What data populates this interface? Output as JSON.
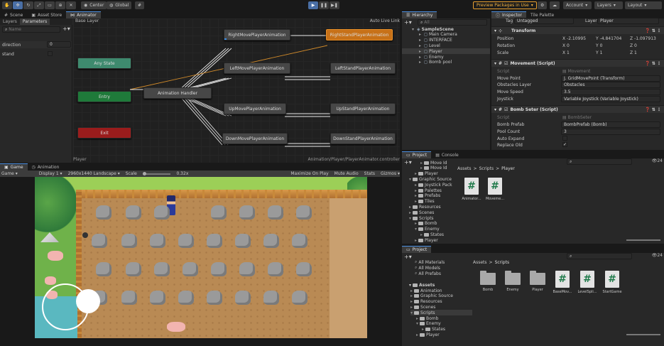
{
  "toolbar": {
    "center_label": "Center",
    "global_label": "Global",
    "preview_packages_label": "Preview Packages in Use",
    "account_label": "Account",
    "layers_label": "Layers",
    "layout_label": "Layout"
  },
  "top_tabs": {
    "scene": "Scene",
    "asset_store": "Asset Store",
    "animator": "Animator"
  },
  "animator": {
    "sub_tabs": {
      "layers": "Layers",
      "parameters": "Parameters"
    },
    "search_placeholder": "Name",
    "params": [
      {
        "name": "direction",
        "value": "0"
      },
      {
        "name": "stand",
        "value": ""
      }
    ],
    "base_layer": "Base Layer",
    "auto_live_link": "Auto Live Link",
    "nodes": {
      "any_state": "Any State",
      "entry": "Entry",
      "exit": "Exit",
      "handler": "Animation Handler",
      "right_move": "RightMovePlayerAnimation",
      "right_stand": "RightStandPlayerAnimation",
      "left_move": "LeftMovePlayerAnimation",
      "left_stand": "LeftStandPlayerAnimation",
      "up_move": "UpMovePlayerAnimation",
      "up_stand": "UpStandPlayerAnimation",
      "down_move": "DownMovePlayerAnimation",
      "down_stand": "DownStandPlayerAnimation"
    },
    "footer_left": "Player",
    "footer_right": "Animation/Player/PlayerAnimator.controller"
  },
  "game": {
    "tabs": {
      "game": "Game",
      "animation": "Animation"
    },
    "mode": "Game",
    "display": "Display 1",
    "resolution": "2960x1440 Landscape",
    "scale_label": "Scale",
    "scale_value": "0.32x",
    "maximize_on_play": "Maximize On Play",
    "mute_audio": "Mute Audio",
    "stats": "Stats",
    "gizmos": "Gizmos"
  },
  "hierarchy": {
    "tab": "Hierarchy",
    "search_placeholder": "All",
    "items": [
      {
        "label": "SampleScene",
        "indent": 0,
        "type": "scene"
      },
      {
        "label": "Main Camera",
        "indent": 1,
        "type": "obj"
      },
      {
        "label": "INTERFACE",
        "indent": 1,
        "type": "obj"
      },
      {
        "label": "Level",
        "indent": 1,
        "type": "obj"
      },
      {
        "label": "Player",
        "indent": 1,
        "type": "obj",
        "selected": true
      },
      {
        "label": "Enemy",
        "indent": 1,
        "type": "obj"
      },
      {
        "label": "Bomb pool",
        "indent": 1,
        "type": "obj"
      }
    ]
  },
  "inspector": {
    "tabs": {
      "inspector": "Inspector",
      "tile_palette": "Tile Palette"
    },
    "tag_label": "Tag",
    "tag_value": "Untagged",
    "layer_label": "Layer",
    "layer_value": "Player",
    "transform": {
      "title": "Transform",
      "position_label": "Position",
      "position": {
        "x": "-2.10995",
        "y": "-4.841704",
        "z": "-1.097913"
      },
      "rotation_label": "Rotation",
      "rotation": {
        "x": "0",
        "y": "0",
        "z": "0"
      },
      "scale_label": "Scale",
      "scale": {
        "x": "1",
        "y": "1",
        "z": "1"
      }
    },
    "movement": {
      "title": "Movement (Script)",
      "script_label": "Script",
      "script_value": "Movement",
      "move_point_label": "Move Point",
      "move_point_value": "J. GridMovePoint (Transform)",
      "obstacles_label": "Obstacles Layer",
      "obstacles_value": "Obstacles",
      "speed_label": "Move Speed",
      "speed_value": "3.5",
      "joystick_label": "Joystick",
      "joystick_value": "Variable Joystick (Variable Joystick)"
    },
    "bomb": {
      "title": "Bomb Seter (Script)",
      "script_label": "Script",
      "script_value": "BombSeter",
      "prefab_label": "Bomb Prefab",
      "prefab_value": "BombPrefab (Bomb)",
      "pool_label": "Pool Count",
      "pool_value": "3",
      "auto_expand_label": "Auto Expand",
      "replace_old_label": "Replace Old"
    }
  },
  "project_top": {
    "tabs": {
      "project": "Project",
      "console": "Console"
    },
    "count": "24",
    "tree": [
      "Move Id",
      "Move Id",
      "Player",
      "Graphic Source",
      "Joystick Pack",
      "Palettes",
      "Prefabs",
      "Tiles",
      "Resources",
      "Scenes",
      "Scripts",
      "Bomb",
      "Enemy",
      "States",
      "Player"
    ],
    "breadcrumb": [
      "Assets",
      "Scripts",
      "Player"
    ],
    "files": [
      "Animator...",
      "Moveme..."
    ]
  },
  "project_bottom": {
    "tab": "Project",
    "count": "24",
    "favorites": [
      "All Materials",
      "All Models",
      "All Prefabs"
    ],
    "assets_label": "Assets",
    "tree": [
      "Animation",
      "Graphic Source",
      "Resources",
      "Scenes",
      "Scripts",
      "Bomb",
      "Enemy",
      "States",
      "Player"
    ],
    "breadcrumb": [
      "Assets",
      "Scripts"
    ],
    "items": [
      {
        "name": "Bomb",
        "type": "folder"
      },
      {
        "name": "Enemy",
        "type": "folder"
      },
      {
        "name": "Player",
        "type": "folder"
      },
      {
        "name": "BaseMov...",
        "type": "script"
      },
      {
        "name": "LevelSpli...",
        "type": "script"
      },
      {
        "name": "StartGame",
        "type": "script"
      }
    ]
  }
}
